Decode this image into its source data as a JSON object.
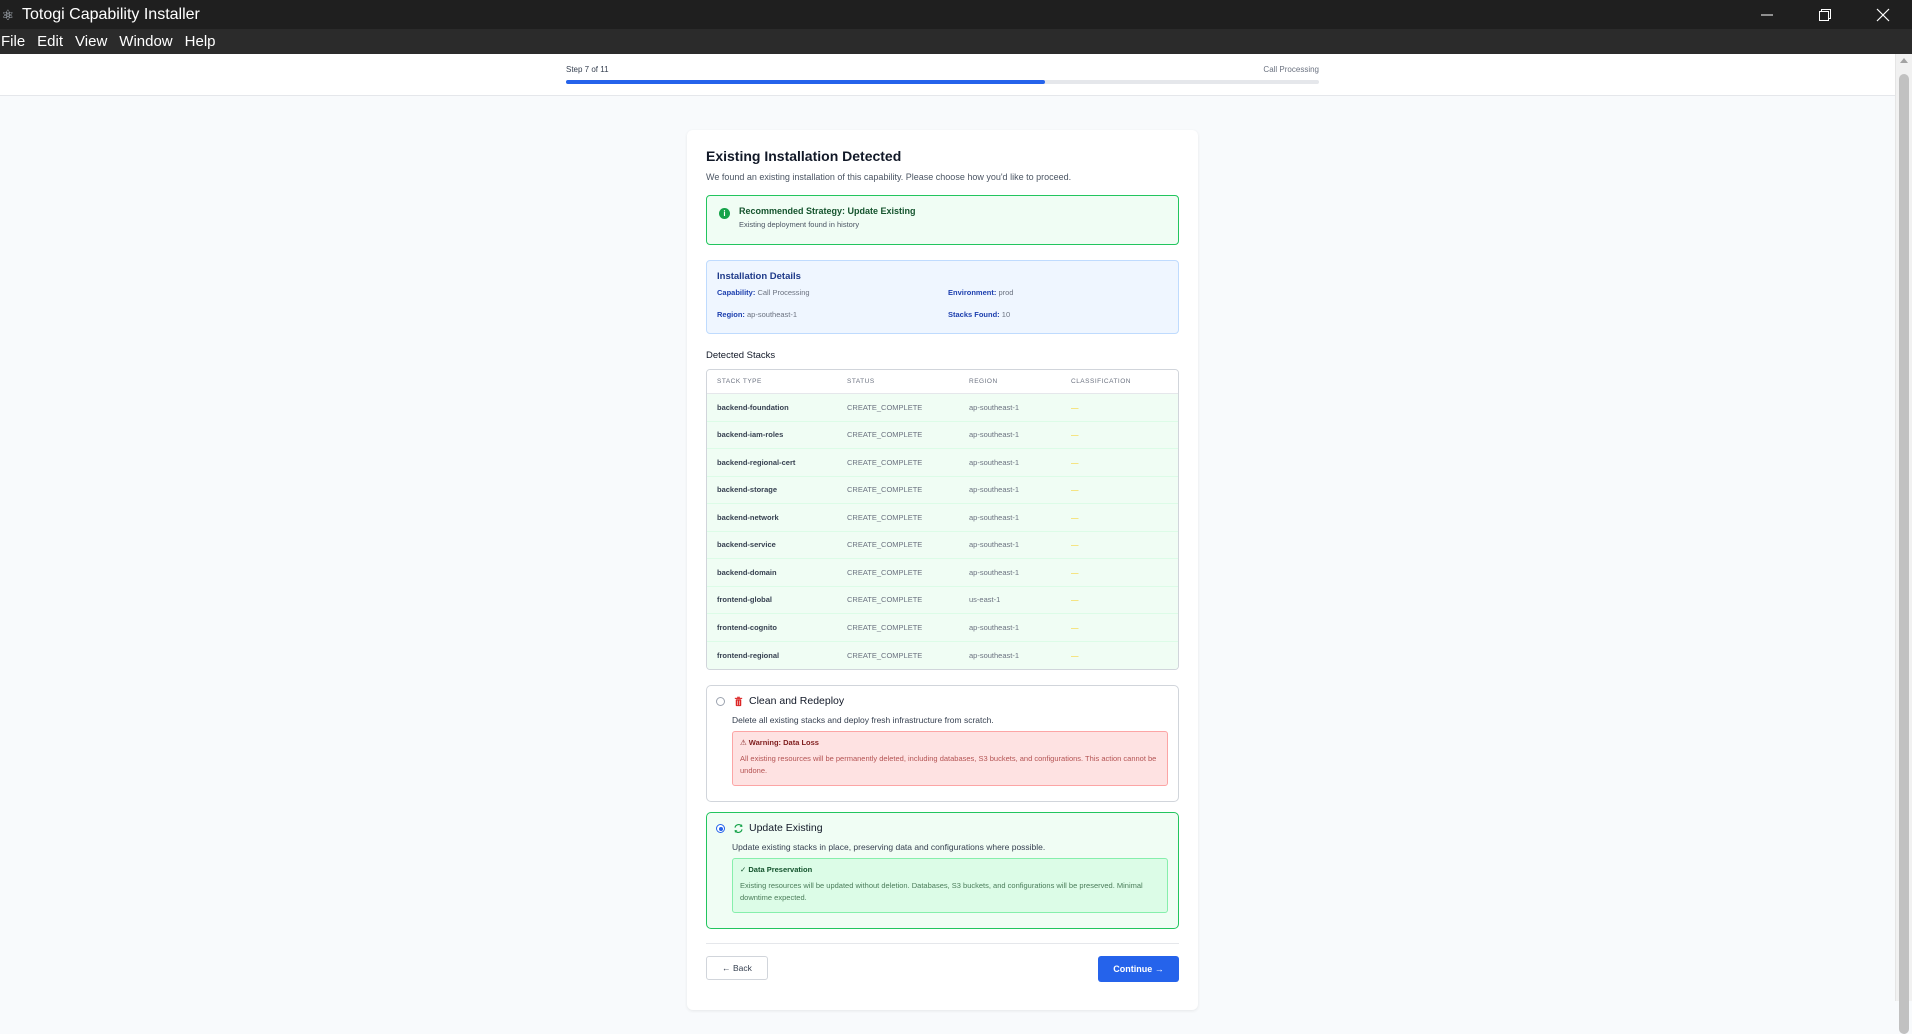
{
  "window": {
    "title": "Totogi Capability Installer",
    "app_icon": "electron-atom-icon"
  },
  "menu": [
    "File",
    "Edit",
    "View",
    "Window",
    "Help"
  ],
  "progress": {
    "step_label": "Step 7 of 11",
    "section_label": "Call Processing",
    "fraction": 0.636
  },
  "card": {
    "title": "Existing Installation Detected",
    "subtitle": "We found an existing installation of this capability. Please choose how you'd like to proceed.",
    "recommendation": {
      "title": "Recommended Strategy: Update Existing",
      "subtitle": "Existing deployment found in history"
    },
    "details": {
      "title": "Installation Details",
      "capability_key": "Capability:",
      "capability_value": "Call Processing",
      "environment_key": "Environment:",
      "environment_value": "prod",
      "region_key": "Region:",
      "region_value": "ap-southeast-1",
      "stacks_key": "Stacks Found:",
      "stacks_value": "10"
    },
    "stacks": {
      "title": "Detected Stacks",
      "headers": [
        "STACK TYPE",
        "STATUS",
        "REGION",
        "CLASSIFICATION"
      ],
      "rows": [
        {
          "type": "backend-foundation",
          "status": "CREATE_COMPLETE",
          "region": "ap-southeast-1",
          "classification": "—"
        },
        {
          "type": "backend-iam-roles",
          "status": "CREATE_COMPLETE",
          "region": "ap-southeast-1",
          "classification": "—"
        },
        {
          "type": "backend-regional-cert",
          "status": "CREATE_COMPLETE",
          "region": "ap-southeast-1",
          "classification": "—"
        },
        {
          "type": "backend-storage",
          "status": "CREATE_COMPLETE",
          "region": "ap-southeast-1",
          "classification": "—"
        },
        {
          "type": "backend-network",
          "status": "CREATE_COMPLETE",
          "region": "ap-southeast-1",
          "classification": "—"
        },
        {
          "type": "backend-service",
          "status": "CREATE_COMPLETE",
          "region": "ap-southeast-1",
          "classification": "—"
        },
        {
          "type": "backend-domain",
          "status": "CREATE_COMPLETE",
          "region": "ap-southeast-1",
          "classification": "—"
        },
        {
          "type": "frontend-global",
          "status": "CREATE_COMPLETE",
          "region": "us-east-1",
          "classification": "—"
        },
        {
          "type": "frontend-cognito",
          "status": "CREATE_COMPLETE",
          "region": "ap-southeast-1",
          "classification": "—"
        },
        {
          "type": "frontend-regional",
          "status": "CREATE_COMPLETE",
          "region": "ap-southeast-1",
          "classification": "—"
        }
      ]
    },
    "options": {
      "clean": {
        "title": "Clean and Redeploy",
        "description": "Delete all existing stacks and deploy fresh infrastructure from scratch.",
        "warning_title": "⚠ Warning: Data Loss",
        "warning_text": "All existing resources will be permanently deleted, including databases, S3 buckets, and configurations. This action cannot be undone.",
        "selected": false
      },
      "update": {
        "title": "Update Existing",
        "description": "Update existing stacks in place, preserving data and configurations where possible.",
        "note_title": "✓ Data Preservation",
        "note_text": "Existing resources will be updated without deletion. Databases, S3 buckets, and configurations will be preserved. Minimal downtime expected.",
        "selected": true
      }
    },
    "buttons": {
      "back": "← Back",
      "continue": "Continue →"
    }
  },
  "colors": {
    "primary": "#2563eb",
    "success": "#22c55e",
    "danger": "#dc2626"
  }
}
